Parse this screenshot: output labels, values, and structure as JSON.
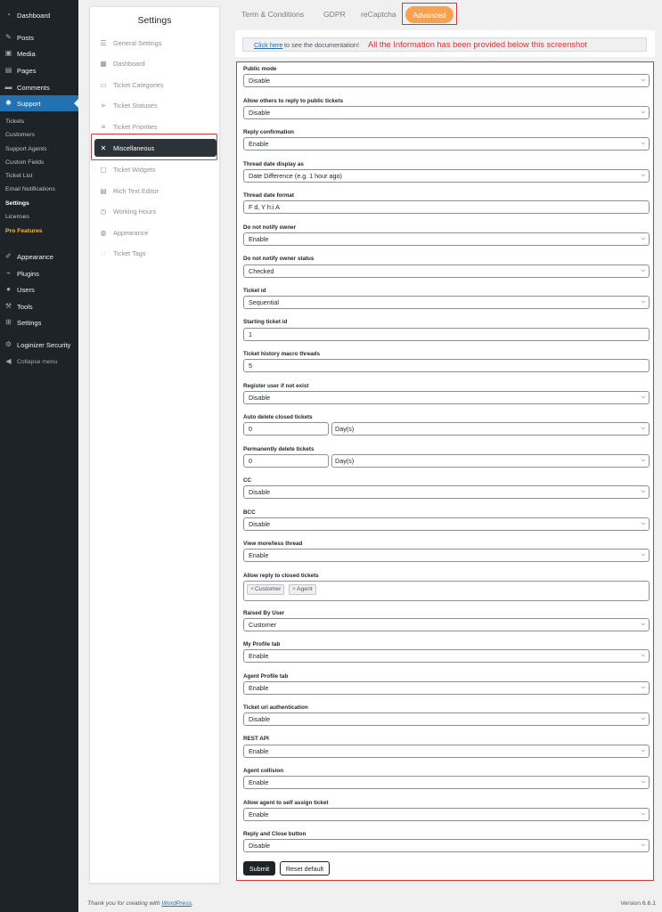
{
  "wp_menu": {
    "items": [
      {
        "label": "Dashboard",
        "icon": "dashboard-icon"
      },
      {
        "label": "Posts",
        "icon": "pushpin-icon"
      },
      {
        "label": "Media",
        "icon": "media-icon"
      },
      {
        "label": "Pages",
        "icon": "pages-icon"
      },
      {
        "label": "Comments",
        "icon": "comments-icon"
      },
      {
        "label": "Support",
        "icon": "support-icon",
        "active": true
      },
      {
        "label": "Appearance",
        "icon": "brush-icon"
      },
      {
        "label": "Plugins",
        "icon": "plugin-icon"
      },
      {
        "label": "Users",
        "icon": "users-icon"
      },
      {
        "label": "Tools",
        "icon": "wrench-icon"
      },
      {
        "label": "Settings",
        "icon": "sliders-icon"
      },
      {
        "label": "Loginizer Security",
        "icon": "gear-icon"
      },
      {
        "label": "Collapse menu",
        "icon": "collapse-icon"
      }
    ],
    "support_submenu": [
      "Tickets",
      "Customers",
      "Support Agents",
      "Custom Fields",
      "Ticket List",
      "Email Notifications",
      "Settings",
      "Licenses",
      "Pro Features"
    ],
    "current_submenu": "Settings"
  },
  "settings_nav": {
    "title": "Settings",
    "items": [
      {
        "label": "General Settings",
        "icon": "sliders-icon"
      },
      {
        "label": "Dashboard",
        "icon": "dashboard-icon"
      },
      {
        "label": "Ticket Categories",
        "icon": "folder-icon"
      },
      {
        "label": "Ticket Statuses",
        "icon": "paper-plane-icon"
      },
      {
        "label": "Ticket Priorities",
        "icon": "priority-icon"
      },
      {
        "label": "Miscellaneous",
        "icon": "tools-icon",
        "selected": true
      },
      {
        "label": "Ticket Widgets",
        "icon": "widgets-icon"
      },
      {
        "label": "Rich Text Editor",
        "icon": "text-editor-icon"
      },
      {
        "label": "Working Hours",
        "icon": "clock-icon"
      },
      {
        "label": "Appearance",
        "icon": "palette-icon"
      },
      {
        "label": "Ticket Tags",
        "icon": "tag-icon"
      }
    ]
  },
  "tabs": [
    {
      "label": "Term & Conditions"
    },
    {
      "label": "GDPR"
    },
    {
      "label": "reCaptcha"
    },
    {
      "label": "Advanced",
      "active": true
    }
  ],
  "doc_notice": {
    "link_text": "Click here",
    "rest_text": "to see the documentation!",
    "note": "All the Information has been provided below this screenshot"
  },
  "form": {
    "fields": [
      {
        "label": "Public mode",
        "type": "select",
        "value": "Disable"
      },
      {
        "label": "Allow others to reply to public tickets",
        "type": "select",
        "value": "Disable"
      },
      {
        "label": "Reply confirmation",
        "type": "select",
        "value": "Enable"
      },
      {
        "label": "Thread date display as",
        "type": "select",
        "value": "Date Difference (e.g. 1 hour ago)"
      },
      {
        "label": "Thread date format",
        "type": "text",
        "value": "F d, Y h:i A"
      },
      {
        "label": "Do not notify owner",
        "type": "select",
        "value": "Enable"
      },
      {
        "label": "Do not notify owner status",
        "type": "select",
        "value": "Checked"
      },
      {
        "label": "Ticket id",
        "type": "select",
        "value": "Sequential"
      },
      {
        "label": "Starting ticket id",
        "type": "text",
        "value": "1"
      },
      {
        "label": "Ticket history macro threads",
        "type": "text",
        "value": "5"
      },
      {
        "label": "Register user if not exist",
        "type": "select",
        "value": "Disable"
      },
      {
        "label": "Auto delete closed tickets",
        "type": "number-unit",
        "value": "0",
        "unit": "Day(s)"
      },
      {
        "label": "Permanently delete tickets",
        "type": "number-unit",
        "value": "0",
        "unit": "Day(s)"
      },
      {
        "label": "CC",
        "type": "select",
        "value": "Disable"
      },
      {
        "label": "BCC",
        "type": "select",
        "value": "Disable"
      },
      {
        "label": "View more/less thread",
        "type": "select",
        "value": "Enable"
      },
      {
        "label": "Allow reply to closed tickets",
        "type": "multi",
        "values": [
          "Customer",
          "Agent"
        ]
      },
      {
        "label": "Raised By User",
        "type": "select",
        "value": "Customer"
      },
      {
        "label": "My Profile tab",
        "type": "select",
        "value": "Enable"
      },
      {
        "label": "Agent Profile tab",
        "type": "select",
        "value": "Enable"
      },
      {
        "label": "Ticket url authentication",
        "type": "select",
        "value": "Disable"
      },
      {
        "label": "REST API",
        "type": "select",
        "value": "Enable"
      },
      {
        "label": "Agent collision",
        "type": "select",
        "value": "Enable"
      },
      {
        "label": "Allow agent to self assign ticket",
        "type": "select",
        "value": "Enable"
      },
      {
        "label": "Reply and Close button",
        "type": "select",
        "value": "Disable"
      }
    ],
    "submit_label": "Submit",
    "reset_label": "Reset default"
  },
  "footer": {
    "thanks_prefix": "Thank you for creating with",
    "thanks_link": "WordPress",
    "thanks_suffix": ".",
    "version": "Version 6.6.1"
  },
  "colors": {
    "admin_bar": "#1d2327",
    "accent": "#2271b1",
    "advanced_tab": "#f6a251",
    "highlight_border": "#d63638",
    "pro_features": "#f0b849"
  }
}
